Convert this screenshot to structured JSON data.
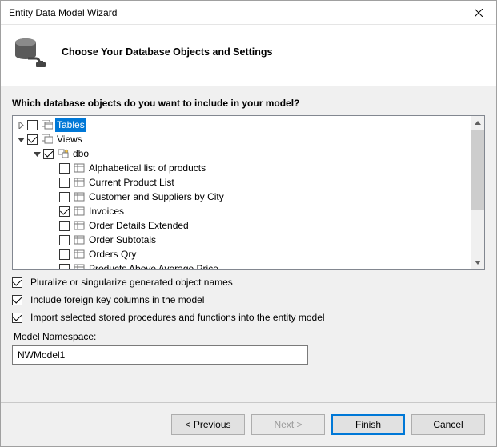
{
  "window": {
    "title": "Entity Data Model Wizard"
  },
  "header": {
    "heading": "Choose Your Database Objects and Settings"
  },
  "body": {
    "question": "Which database objects do you want to include in your model?",
    "tree": {
      "tables": {
        "label": "Tables",
        "checked": false,
        "expanded": false,
        "selected": true
      },
      "views": {
        "label": "Views",
        "checked": true,
        "expanded": true,
        "dbo": {
          "label": "dbo",
          "checked": true,
          "expanded": true,
          "items": [
            {
              "label": "Alphabetical list of products",
              "checked": false
            },
            {
              "label": "Current Product List",
              "checked": false
            },
            {
              "label": "Customer and Suppliers by City",
              "checked": false
            },
            {
              "label": "Invoices",
              "checked": true
            },
            {
              "label": "Order Details Extended",
              "checked": false
            },
            {
              "label": "Order Subtotals",
              "checked": false
            },
            {
              "label": "Orders Qry",
              "checked": false
            },
            {
              "label": "Products Above Average Price",
              "checked": false
            }
          ]
        }
      }
    },
    "options": {
      "pluralize": {
        "label": "Pluralize or singularize generated object names",
        "checked": true
      },
      "fk": {
        "label": "Include foreign key columns in the model",
        "checked": true
      },
      "sprocs": {
        "label": "Import selected stored procedures and functions into the entity model",
        "checked": true
      }
    },
    "namespace": {
      "label": "Model Namespace:",
      "value": "NWModel1"
    }
  },
  "footer": {
    "previous": "< Previous",
    "next": "Next >",
    "finish": "Finish",
    "cancel": "Cancel"
  }
}
